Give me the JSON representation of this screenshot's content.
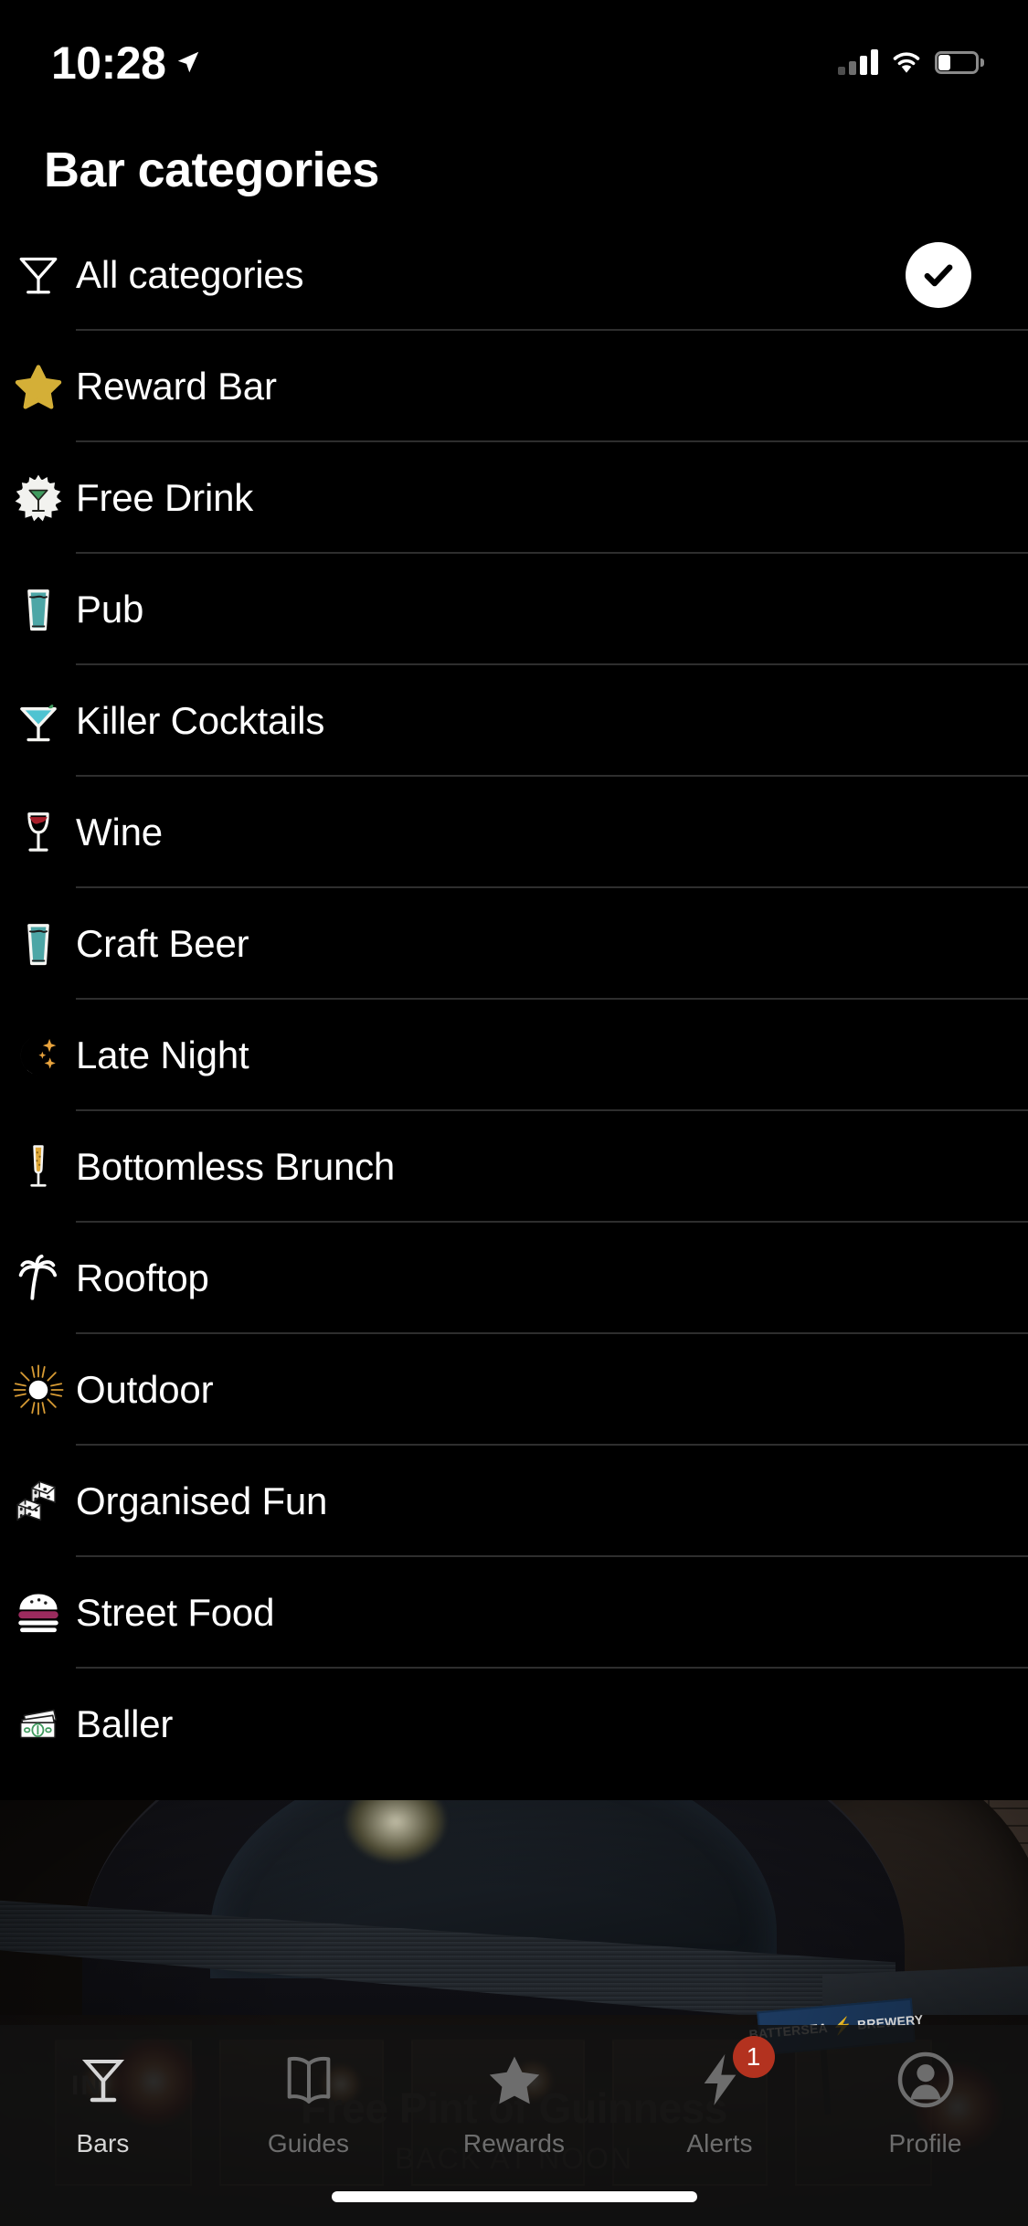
{
  "status_bar": {
    "time": "10:28",
    "location_icon": "location-arrow-icon",
    "signal_icon": "cellular-signal-icon",
    "wifi_icon": "wifi-icon",
    "battery_icon": "battery-icon"
  },
  "header": {
    "title": "Bar categories"
  },
  "categories": [
    {
      "label": "All categories",
      "icon": "martini-glass-outline-icon",
      "selected": true
    },
    {
      "label": "Reward Bar",
      "icon": "gold-star-icon",
      "selected": false
    },
    {
      "label": "Free Drink",
      "icon": "free-drink-badge-icon",
      "selected": false
    },
    {
      "label": "Pub",
      "icon": "pint-glass-icon",
      "selected": false
    },
    {
      "label": "Killer Cocktails",
      "icon": "cocktail-glass-icon",
      "selected": false
    },
    {
      "label": "Wine",
      "icon": "wine-glass-icon",
      "selected": false
    },
    {
      "label": "Craft Beer",
      "icon": "pint-glass-icon",
      "selected": false
    },
    {
      "label": "Late Night",
      "icon": "crescent-moon-stars-icon",
      "selected": false
    },
    {
      "label": "Bottomless Brunch",
      "icon": "champagne-flute-icon",
      "selected": false
    },
    {
      "label": "Rooftop",
      "icon": "palm-tree-icon",
      "selected": false
    },
    {
      "label": "Outdoor",
      "icon": "sun-icon",
      "selected": false
    },
    {
      "label": "Organised Fun",
      "icon": "dice-icon",
      "selected": false
    },
    {
      "label": "Street Food",
      "icon": "burger-icon",
      "selected": false
    },
    {
      "label": "Baller",
      "icon": "banknotes-icon",
      "selected": false
    }
  ],
  "selected_check_icon": "check-circle-icon",
  "background_photo": {
    "sign_text_left": "BATTERSEA",
    "sign_text_right": "BREWERY",
    "sign_bolt": "⚡",
    "door_label": "IN"
  },
  "promo": {
    "title": "Free Pint of Guinness",
    "subtitle": "BACK AT NOON"
  },
  "tab_bar": [
    {
      "label": "Bars",
      "icon": "martini-glass-icon",
      "active": true,
      "badge": null
    },
    {
      "label": "Guides",
      "icon": "open-book-icon",
      "active": false,
      "badge": null
    },
    {
      "label": "Rewards",
      "icon": "star-icon",
      "active": false,
      "badge": null
    },
    {
      "label": "Alerts",
      "icon": "lightning-bolt-icon",
      "active": false,
      "badge": "1"
    },
    {
      "label": "Profile",
      "icon": "person-avatar-icon",
      "active": false,
      "badge": null
    }
  ],
  "colors": {
    "background": "#000000",
    "divider": "#2e2e2e",
    "text_primary": "#ffffff",
    "tab_inactive": "#6d6d6d",
    "tab_active": "#d6d6d6",
    "badge_red": "#b3321f",
    "gold": "#d4af37",
    "teal": "#4da6a6",
    "wine_red": "#a61e2a",
    "green": "#3f9a5e",
    "magenta": "#9b2b5e"
  }
}
